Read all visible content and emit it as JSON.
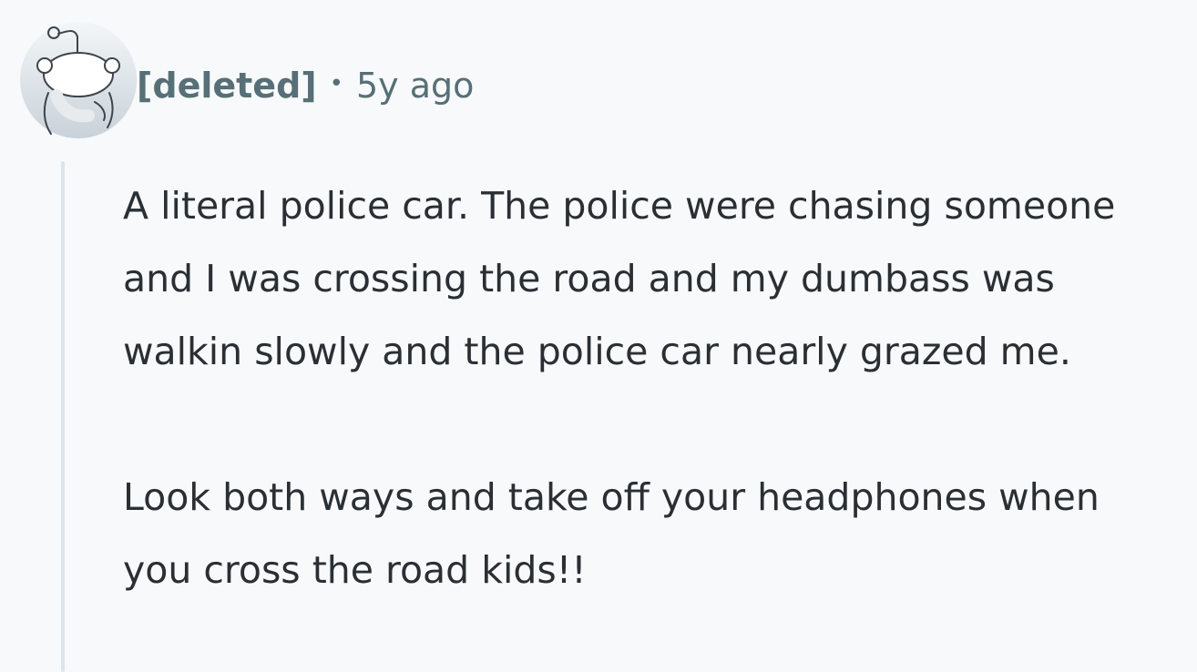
{
  "comment": {
    "author": "[deleted]",
    "separator": "•",
    "timestamp": "5y ago",
    "avatar_icon": "reddit-snoo-avatar-icon",
    "paragraphs": [
      "A literal police car. The police were chasing someone and I was crossing the road and my dumbass was walkin slowly and the police car nearly grazed me.",
      "Look both ways and take off your headphones when you cross the road kids!!"
    ]
  },
  "colors": {
    "background": "#f8f9fb",
    "meta_text": "#576f76",
    "body_text": "#2a2f34",
    "thread_line": "#dde4ea"
  }
}
